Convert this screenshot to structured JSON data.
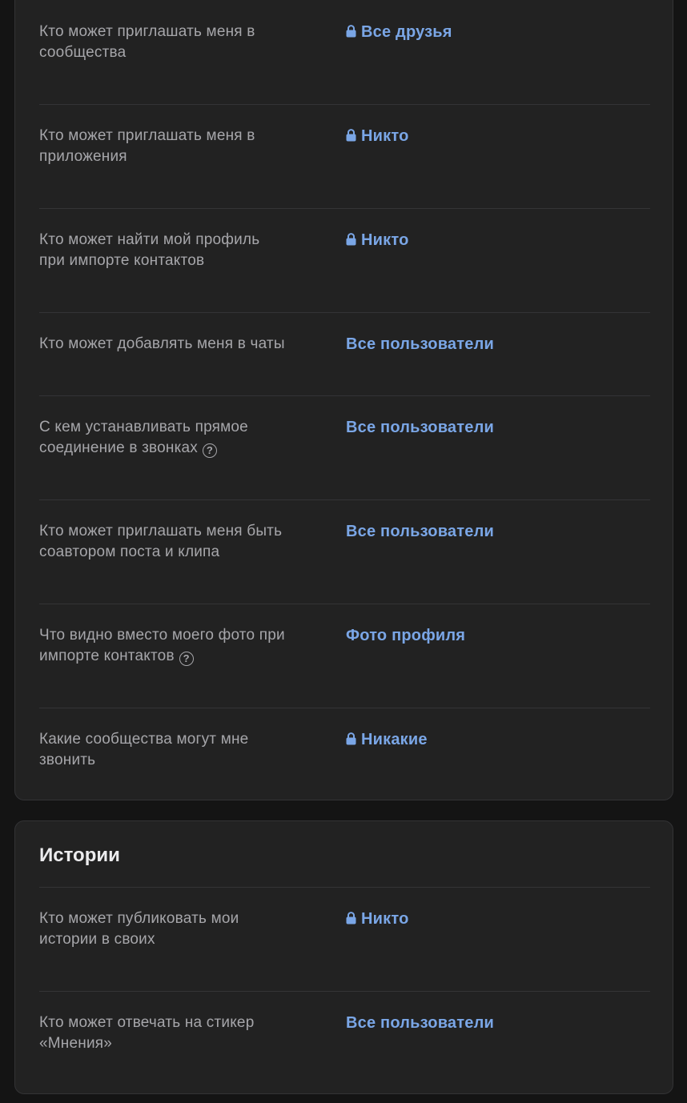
{
  "privacy": {
    "rows": [
      {
        "label_lines": [
          "Кто может приглашать меня в",
          "сообщества"
        ],
        "value": "Все друзья",
        "locked": true
      },
      {
        "label_lines": [
          "Кто может приглашать меня в",
          "приложения"
        ],
        "value": "Никто",
        "locked": true
      },
      {
        "label_lines": [
          "Кто может найти мой профиль",
          "при импорте контактов"
        ],
        "value": "Никто",
        "locked": true
      },
      {
        "label_lines": [
          "Кто может добавлять меня в чаты"
        ],
        "value": "Все пользователи",
        "locked": false
      },
      {
        "label_lines": [
          "С кем устанавливать прямое",
          "соединение в звонках"
        ],
        "value": "Все пользователи",
        "locked": false,
        "help": true
      },
      {
        "label_lines": [
          "Кто может приглашать меня быть",
          "соавтором поста и клипа"
        ],
        "value": "Все пользователи",
        "locked": false
      },
      {
        "label_lines": [
          "Что видно вместо моего фото при",
          "импорте контактов"
        ],
        "value": "Фото профиля",
        "locked": false,
        "help": true
      },
      {
        "label_lines": [
          "Какие сообщества могут мне",
          "звонить"
        ],
        "value": "Никакие",
        "locked": true
      }
    ]
  },
  "stories": {
    "title": "Истории",
    "rows": [
      {
        "label_lines": [
          "Кто может публиковать мои",
          "истории в своих"
        ],
        "value": "Никто",
        "locked": true
      },
      {
        "label_lines": [
          "Кто может отвечать на стикер",
          "«Мнения»"
        ],
        "value": "Все пользователи",
        "locked": false
      }
    ]
  },
  "icons": {
    "lock": "lock-icon",
    "help": "question-circle-icon"
  },
  "colors": {
    "background": "#141414",
    "card": "#222222",
    "label": "#a6a6aa",
    "accent": "#7aa6e6",
    "title": "#ececee"
  }
}
